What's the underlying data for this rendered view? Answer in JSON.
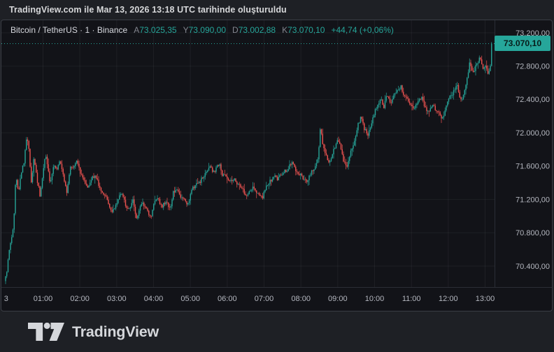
{
  "attribution": {
    "text": "TradingView.com ile Mar 13, 2026 13:18 UTC tarihinde oluşturuldu"
  },
  "legend": {
    "symbol_line": "Bitcoin / TetherUS · 1 · Binance",
    "ohlc": [
      {
        "label": "A",
        "value": "73.025,35"
      },
      {
        "label": "Y",
        "value": "73.090,00"
      },
      {
        "label": "D",
        "value": "73.002,88"
      },
      {
        "label": "K",
        "value": "73.070,10"
      }
    ],
    "change": "+44,74 (+0,06%)"
  },
  "price_scale": {
    "tag": "73.070,10",
    "tag_value": 73070.1,
    "ticks": [
      {
        "label": "73.200,00",
        "value": 73200
      },
      {
        "label": "72.800,00",
        "value": 72800
      },
      {
        "label": "72.400,00",
        "value": 72400
      },
      {
        "label": "72.000,00",
        "value": 72000
      },
      {
        "label": "71.600,00",
        "value": 71600
      },
      {
        "label": "71.200,00",
        "value": 71200
      },
      {
        "label": "70.800,00",
        "value": 70800
      },
      {
        "label": "70.400,00",
        "value": 70400
      }
    ]
  },
  "time_scale": {
    "ticks": [
      {
        "label": "3",
        "minutes": 0,
        "grid": false
      },
      {
        "label": "01:00",
        "minutes": 60,
        "grid": true
      },
      {
        "label": "02:00",
        "minutes": 120,
        "grid": true
      },
      {
        "label": "03:00",
        "minutes": 180,
        "grid": true
      },
      {
        "label": "04:00",
        "minutes": 240,
        "grid": true
      },
      {
        "label": "05:00",
        "minutes": 300,
        "grid": true
      },
      {
        "label": "06:00",
        "minutes": 360,
        "grid": true
      },
      {
        "label": "07:00",
        "minutes": 420,
        "grid": true
      },
      {
        "label": "08:00",
        "minutes": 480,
        "grid": true
      },
      {
        "label": "09:00",
        "minutes": 540,
        "grid": true
      },
      {
        "label": "10:00",
        "minutes": 600,
        "grid": true
      },
      {
        "label": "11:00",
        "minutes": 660,
        "grid": true
      },
      {
        "label": "12:00",
        "minutes": 720,
        "grid": true
      },
      {
        "label": "13:00",
        "minutes": 780,
        "grid": true
      }
    ]
  },
  "footer": {
    "brand": "TradingView"
  },
  "colors": {
    "up": "#26a69a",
    "down": "#ef5350",
    "last_price_line": "#26a69a",
    "tag_bg": "#26a69a",
    "tag_text": "#081e1b",
    "grid": "rgba(243,246,252,0.055)",
    "axis_text": "#b4b7bf",
    "separator": "#2b2e36"
  },
  "chart_data": {
    "type": "candlestick",
    "title": "Bitcoin / TetherUS · 1 · Binance",
    "interval": "1 minute",
    "date": "Mar 13, 2026",
    "time_utc": "13:18",
    "open": 73025.35,
    "high": 73090.0,
    "low": 73002.88,
    "close": 73070.1,
    "change_abs": 44.74,
    "change_pct": 0.06,
    "ylim": [
      70150,
      73330
    ],
    "xlim_minutes": [
      0,
      795
    ],
    "y_ticks": [
      70400,
      70800,
      71200,
      71600,
      72000,
      72400,
      72800,
      73200
    ],
    "x_ticks_minutes": [
      0,
      60,
      120,
      180,
      240,
      300,
      360,
      420,
      480,
      540,
      600,
      660,
      720,
      780
    ],
    "grid": true,
    "series_waypoints": [
      [
        0,
        70280
      ],
      [
        4,
        70520
      ],
      [
        8,
        70720
      ],
      [
        12,
        70850
      ],
      [
        14,
        71200
      ],
      [
        16,
        71500
      ],
      [
        20,
        71280
      ],
      [
        24,
        71500
      ],
      [
        29,
        71650
      ],
      [
        34,
        71970
      ],
      [
        38,
        71720
      ],
      [
        41,
        71380
      ],
      [
        45,
        71700
      ],
      [
        49,
        71500
      ],
      [
        55,
        71250
      ],
      [
        59,
        71480
      ],
      [
        64,
        71730
      ],
      [
        69,
        71520
      ],
      [
        72,
        71380
      ],
      [
        78,
        71620
      ],
      [
        83,
        71550
      ],
      [
        88,
        71670
      ],
      [
        94,
        71450
      ],
      [
        99,
        71270
      ],
      [
        104,
        71580
      ],
      [
        110,
        71600
      ],
      [
        115,
        71660
      ],
      [
        121,
        71520
      ],
      [
        128,
        71400
      ],
      [
        134,
        71330
      ],
      [
        139,
        71450
      ],
      [
        146,
        71480
      ],
      [
        153,
        71320
      ],
      [
        160,
        71270
      ],
      [
        167,
        71150
      ],
      [
        172,
        71060
      ],
      [
        178,
        71120
      ],
      [
        184,
        71240
      ],
      [
        189,
        71260
      ],
      [
        195,
        71120
      ],
      [
        201,
        71080
      ],
      [
        206,
        71220
      ],
      [
        212,
        70960
      ],
      [
        218,
        71100
      ],
      [
        223,
        71150
      ],
      [
        229,
        71080
      ],
      [
        235,
        70970
      ],
      [
        241,
        71150
      ],
      [
        247,
        71200
      ],
      [
        254,
        71120
      ],
      [
        261,
        71180
      ],
      [
        267,
        71080
      ],
      [
        272,
        71280
      ],
      [
        278,
        71300
      ],
      [
        285,
        71220
      ],
      [
        291,
        71180
      ],
      [
        295,
        71120
      ],
      [
        302,
        71320
      ],
      [
        309,
        71380
      ],
      [
        316,
        71420
      ],
      [
        323,
        71500
      ],
      [
        328,
        71550
      ],
      [
        332,
        71600
      ],
      [
        337,
        71520
      ],
      [
        343,
        71580
      ],
      [
        347,
        71630
      ],
      [
        352,
        71500
      ],
      [
        358,
        71480
      ],
      [
        364,
        71420
      ],
      [
        370,
        71450
      ],
      [
        377,
        71380
      ],
      [
        384,
        71330
      ],
      [
        391,
        71250
      ],
      [
        397,
        71300
      ],
      [
        402,
        71350
      ],
      [
        409,
        71280
      ],
      [
        417,
        71210
      ],
      [
        423,
        71350
      ],
      [
        430,
        71420
      ],
      [
        436,
        71480
      ],
      [
        443,
        71440
      ],
      [
        450,
        71520
      ],
      [
        457,
        71550
      ],
      [
        465,
        71640
      ],
      [
        472,
        71550
      ],
      [
        479,
        71500
      ],
      [
        484,
        71450
      ],
      [
        489,
        71400
      ],
      [
        496,
        71520
      ],
      [
        503,
        71580
      ],
      [
        508,
        71700
      ],
      [
        512,
        72100
      ],
      [
        515,
        71900
      ],
      [
        520,
        71750
      ],
      [
        525,
        71620
      ],
      [
        530,
        71720
      ],
      [
        536,
        71850
      ],
      [
        540,
        71940
      ],
      [
        546,
        71780
      ],
      [
        550,
        71650
      ],
      [
        554,
        71580
      ],
      [
        560,
        71750
      ],
      [
        568,
        71900
      ],
      [
        573,
        72100
      ],
      [
        578,
        72190
      ],
      [
        583,
        72050
      ],
      [
        589,
        71980
      ],
      [
        594,
        72100
      ],
      [
        600,
        72250
      ],
      [
        605,
        72350
      ],
      [
        611,
        72420
      ],
      [
        615,
        72300
      ],
      [
        620,
        72450
      ],
      [
        626,
        72350
      ],
      [
        631,
        72440
      ],
      [
        637,
        72500
      ],
      [
        643,
        72550
      ],
      [
        648,
        72450
      ],
      [
        654,
        72400
      ],
      [
        660,
        72320
      ],
      [
        665,
        72280
      ],
      [
        671,
        72380
      ],
      [
        677,
        72420
      ],
      [
        682,
        72300
      ],
      [
        688,
        72250
      ],
      [
        694,
        72320
      ],
      [
        700,
        72280
      ],
      [
        705,
        72220
      ],
      [
        711,
        72180
      ],
      [
        717,
        72320
      ],
      [
        722,
        72420
      ],
      [
        728,
        72480
      ],
      [
        734,
        72600
      ],
      [
        738,
        72450
      ],
      [
        742,
        72380
      ],
      [
        746,
        72500
      ],
      [
        751,
        72650
      ],
      [
        755,
        72850
      ],
      [
        760,
        72700
      ],
      [
        764,
        72780
      ],
      [
        769,
        72860
      ],
      [
        772,
        72920
      ],
      [
        776,
        72750
      ],
      [
        780,
        72820
      ],
      [
        785,
        72700
      ],
      [
        788,
        72800
      ],
      [
        791,
        72950
      ],
      [
        793,
        73070
      ]
    ]
  }
}
